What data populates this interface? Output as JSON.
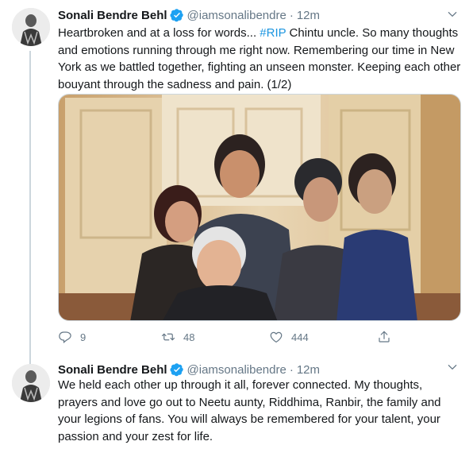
{
  "tweets": [
    {
      "author_name": "Sonali Bendre Behl",
      "handle": "@iamsonalibendre",
      "separator": "·",
      "time": "12m",
      "text_before": "Heartbroken and at a loss for words... ",
      "hashtag": "#RIP",
      "text_after": " Chintu uncle. So many thoughts and emotions running through me right now. Remembering our time in New York as we battled together, fighting an unseen monster. Keeping each other bouyant through the sadness and pain. (1/2)",
      "actions": {
        "replies": "9",
        "retweets": "48",
        "likes": "444"
      }
    },
    {
      "author_name": "Sonali Bendre Behl",
      "handle": "@iamsonalibendre",
      "separator": "·",
      "time": "12m",
      "text": "We held each other up through it all, forever connected. My thoughts, prayers and love go out to Neetu aunty, Riddhima, Ranbir, the family and your legions of fans. You will always be remembered for your talent, your passion and your zest for life."
    }
  ],
  "colors": {
    "link": "#1b95e0",
    "verified": "#1da1f2",
    "muted": "#657786",
    "text": "#14171a"
  },
  "icons": [
    "verified-badge-icon",
    "chevron-down-icon",
    "reply-icon",
    "retweet-icon",
    "like-icon",
    "share-icon"
  ]
}
